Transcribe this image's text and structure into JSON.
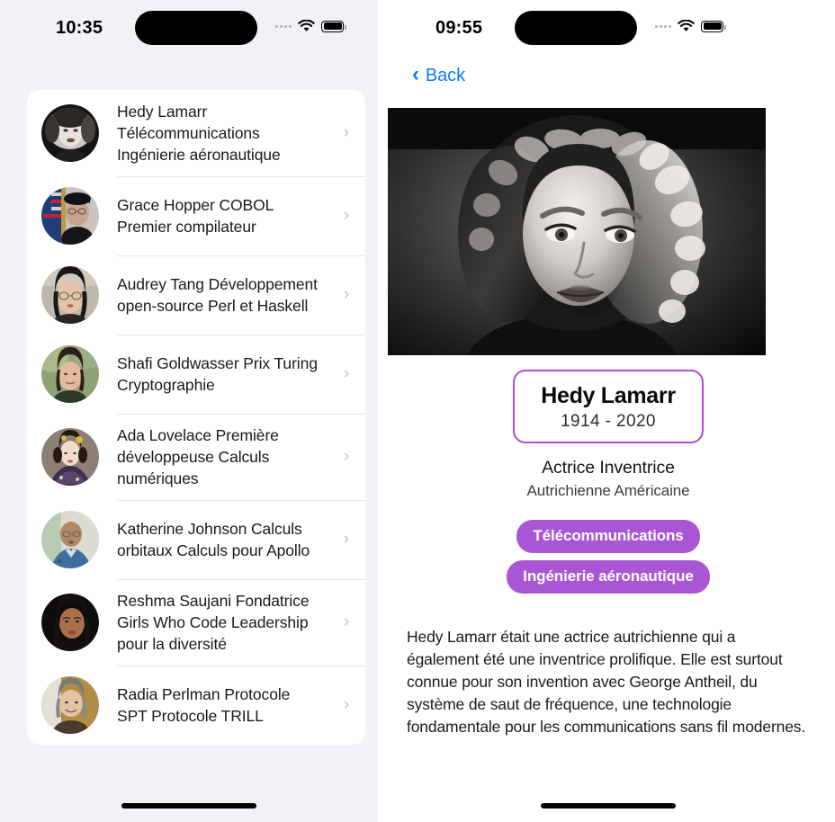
{
  "list_screen": {
    "status_bar": {
      "time": "10:35",
      "cellular_icon": "cellular-dots-icon",
      "wifi_icon": "wifi-icon",
      "battery_icon": "battery-icon"
    },
    "people": [
      {
        "name": "Hedy Lamarr",
        "description": "Télécommunications Ingénierie aéronautique",
        "avatar_icon": "avatar-hedy-lamarr",
        "chevron": "›"
      },
      {
        "name": "Grace Hopper",
        "description": "COBOL Premier compilateur",
        "avatar_icon": "avatar-grace-hopper",
        "chevron": "›"
      },
      {
        "name": "Audrey Tang",
        "description": "Développement open-source Perl et Haskell",
        "avatar_icon": "avatar-audrey-tang",
        "chevron": "›"
      },
      {
        "name": "Shafi Goldwasser",
        "description": "Prix Turing Cryptographie",
        "avatar_icon": "avatar-shafi-goldwasser",
        "chevron": "›"
      },
      {
        "name": "Ada Lovelace",
        "description": "Première développeuse Calculs numériques",
        "avatar_icon": "avatar-ada-lovelace",
        "chevron": "›"
      },
      {
        "name": "Katherine Johnson",
        "description": "Calculs orbitaux Calculs pour Apollo",
        "avatar_icon": "avatar-katherine-johnson",
        "chevron": "›"
      },
      {
        "name": "Reshma Saujani",
        "description": "Fondatrice Girls Who Code Leadership pour la diversité",
        "avatar_icon": "avatar-reshma-saujani",
        "chevron": "›"
      },
      {
        "name": "Radia Perlman",
        "description": "Protocole SPT Protocole TRILL",
        "avatar_icon": "avatar-radia-perlman",
        "chevron": "›"
      }
    ],
    "rows": [
      {
        "text": "Hedy Lamarr Télécommunications Ingénierie aéronautique"
      },
      {
        "text": "Grace Hopper COBOL Premier compilateur"
      },
      {
        "text": "Audrey Tang Développement open-source Perl et Haskell"
      },
      {
        "text": "Shafi Goldwasser Prix Turing Cryptographie"
      },
      {
        "text": "Ada Lovelace Première développeuse Calculs numériques"
      },
      {
        "text": "Katherine Johnson Calculs orbitaux Calculs pour Apollo"
      },
      {
        "text": "Reshma Saujani Fondatrice Girls Who Code Leadership pour la diversité"
      },
      {
        "text": "Radia Perlman Protocole SPT Protocole TRILL"
      }
    ]
  },
  "detail_screen": {
    "status_bar": {
      "time": "09:55",
      "cellular_icon": "cellular-dots-icon",
      "wifi_icon": "wifi-icon",
      "battery_icon": "battery-icon"
    },
    "nav": {
      "back_label": "Back",
      "back_icon": "chevron-left-icon"
    },
    "hero_image_alt": "Hedy Lamarr black and white portrait",
    "name": "Hedy Lamarr",
    "years": "1914  -  2020",
    "occupations": "Actrice  Inventrice",
    "nationalities": "Autrichienne  Américaine",
    "tags": [
      "Télécommunications",
      "Ingénierie aéronautique"
    ],
    "biography": "Hedy Lamarr était une actrice autrichienne qui a également été une inventrice prolifique. Elle est surtout connue pour son invention avec George Antheil, du système de saut de fréquence, une technologie fondamentale pour les communications sans fil modernes."
  },
  "colors": {
    "screen_background": "#f2f1f6",
    "card_background": "#ffffff",
    "accent_purple": "#a856d4",
    "name_card_border": "#b14ae0",
    "link_blue": "#0a7bff",
    "separator": "#e6e6e8",
    "chevron_gray": "#c2c2c7"
  }
}
